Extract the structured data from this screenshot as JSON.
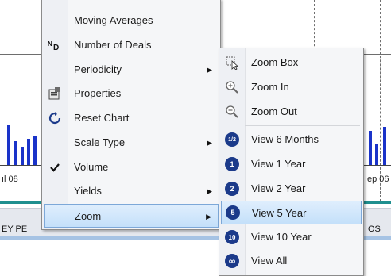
{
  "background": {
    "axis_left_label": "ıl 08",
    "axis_right_label": "ep 06",
    "strip_left_text": "EY PE",
    "strip_right_text": "OS"
  },
  "main_menu": {
    "items": [
      {
        "label": "Moving Averages",
        "icon": "moving-averages-icon"
      },
      {
        "label": "Number of Deals",
        "icon": "number-of-deals-icon",
        "glyph": "ᴺᴅ"
      },
      {
        "label": "Periodicity",
        "submenu": true
      },
      {
        "label": "Properties",
        "icon": "properties-icon"
      },
      {
        "label": "Reset Chart",
        "icon": "reset-chart-icon",
        "glyph": "↺"
      },
      {
        "label": "Scale Type",
        "submenu": true
      },
      {
        "label": "Volume",
        "icon": "check-icon",
        "glyph": "✔"
      },
      {
        "label": "Yields",
        "submenu": true
      },
      {
        "label": "Zoom",
        "submenu": true,
        "highlighted": true
      }
    ]
  },
  "zoom_menu": {
    "items": [
      {
        "label": "Zoom Box",
        "icon": "zoom-box-icon"
      },
      {
        "label": "Zoom In",
        "icon": "zoom-in-icon"
      },
      {
        "label": "Zoom Out",
        "icon": "zoom-out-icon"
      },
      {
        "label": "View 6 Months",
        "icon": "view-6-months-icon",
        "glyph": "1/2"
      },
      {
        "label": "View 1 Year",
        "icon": "view-1-year-icon",
        "glyph": "1"
      },
      {
        "label": "View 2 Year",
        "icon": "view-2-year-icon",
        "glyph": "2"
      },
      {
        "label": "View 5 Year",
        "icon": "view-5-year-icon",
        "glyph": "5",
        "highlighted": true
      },
      {
        "label": "View 10 Year",
        "icon": "view-10-year-icon",
        "glyph": "10"
      },
      {
        "label": "View All",
        "icon": "view-all-icon",
        "glyph": "∞"
      }
    ]
  },
  "colors": {
    "bars": "#1a33c9",
    "highlight": "#c4e0fa",
    "icon_blue": "#1b3a8a"
  }
}
